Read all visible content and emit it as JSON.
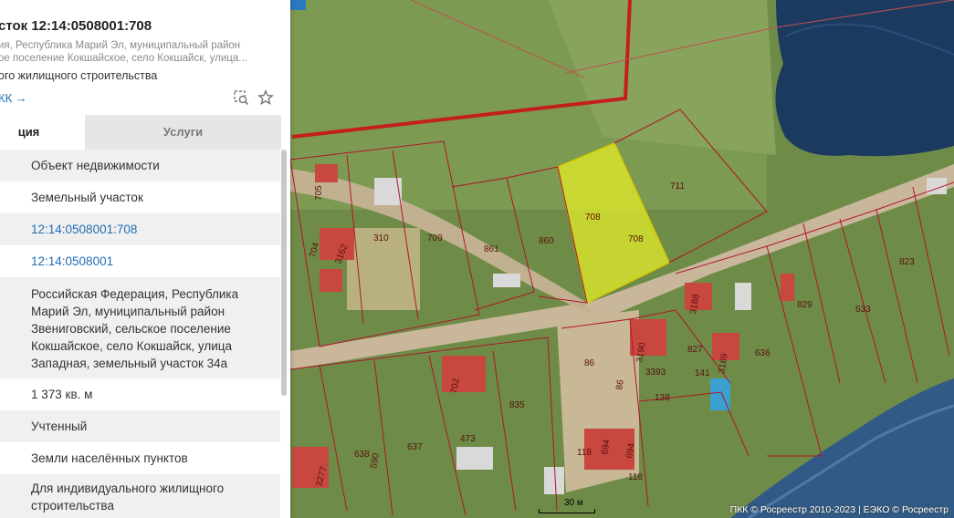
{
  "map": {
    "plots": [
      {
        "id": "p705",
        "label": "705"
      },
      {
        "id": "p704",
        "label": "704"
      },
      {
        "id": "p3162",
        "label": "3162"
      },
      {
        "id": "p310",
        "label": "310"
      },
      {
        "id": "p709",
        "label": "709"
      },
      {
        "id": "p861",
        "label": "861"
      },
      {
        "id": "p860",
        "label": "860"
      },
      {
        "id": "p708a",
        "label": "708"
      },
      {
        "id": "p708b",
        "label": "708"
      },
      {
        "id": "p711",
        "label": "711"
      },
      {
        "id": "p823",
        "label": "823"
      },
      {
        "id": "p829",
        "label": "829"
      },
      {
        "id": "p633",
        "label": "633"
      },
      {
        "id": "p3188",
        "label": "3188"
      },
      {
        "id": "p636",
        "label": "636"
      },
      {
        "id": "p827",
        "label": "827"
      },
      {
        "id": "p141",
        "label": "141"
      },
      {
        "id": "p3189",
        "label": "3189"
      },
      {
        "id": "p3190",
        "label": "3190"
      },
      {
        "id": "p3393",
        "label": "3393"
      },
      {
        "id": "p138",
        "label": "138"
      },
      {
        "id": "p86a",
        "label": "86"
      },
      {
        "id": "p86b",
        "label": "86"
      },
      {
        "id": "p702",
        "label": "702"
      },
      {
        "id": "p835",
        "label": "835"
      },
      {
        "id": "p473",
        "label": "473"
      },
      {
        "id": "p637",
        "label": "637"
      },
      {
        "id": "p638",
        "label": "638"
      },
      {
        "id": "p590",
        "label": "590"
      },
      {
        "id": "p3277",
        "label": "3277"
      },
      {
        "id": "p118a",
        "label": "118"
      },
      {
        "id": "p694a",
        "label": "694"
      },
      {
        "id": "p694b",
        "label": "694"
      },
      {
        "id": "p118b",
        "label": "118"
      }
    ],
    "scale_label": "30 м",
    "copyright": "ПКК © Росреестр 2010-2023 | ЕЭКО © Росреестр"
  },
  "panel": {
    "title": "сток 12:14:0508001:708",
    "address_line1": "ия, Республика Марий Эл, муниципальный район",
    "address_line2": "ое поселение Кокшайское, село Кокшайск, улица...",
    "purpose": "ого жилищного строительства",
    "pkk_link": "КК →",
    "tabs": {
      "info": "ция",
      "services": "Услуги"
    },
    "rows": [
      {
        "value": "Объект недвижимости"
      },
      {
        "value": "Земельный участок"
      },
      {
        "value": "12:14:0508001:708"
      },
      {
        "value": "12:14:0508001"
      },
      {
        "value": "Российская Федерация, Республика Марий Эл, муниципальный район Звениговский, сельское поселение Кокшайское, село Кокшайск, улица Западная, земельный участок 34а"
      },
      {
        "value": "1 373 кв. м"
      },
      {
        "value": "Учтенный"
      },
      {
        "value": "Земли населённых пунктов"
      },
      {
        "value": "Для индивидуального жилищного строительства"
      }
    ]
  }
}
